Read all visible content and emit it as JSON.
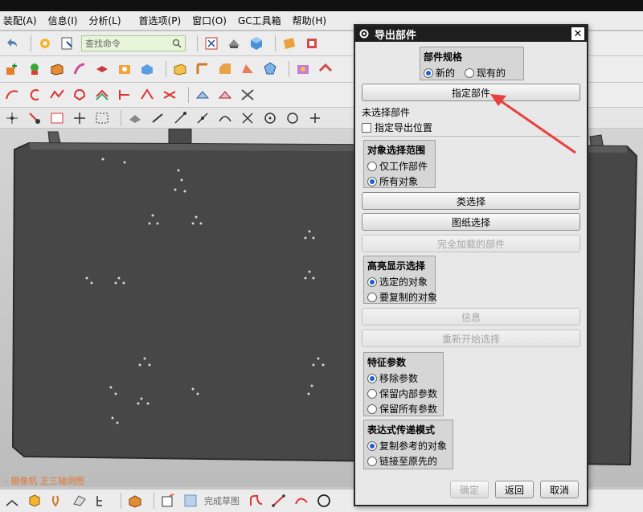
{
  "menubar": {
    "items": [
      "装配(A)",
      "信息(I)",
      "分析(L)",
      "首选项(P)",
      "窗口(O)",
      "GC工具箱",
      "帮助(H)"
    ]
  },
  "toolbar": {
    "search_placeholder": "查找命令"
  },
  "viewport": {
    "camera_label": "- 摄像机 正三轴测图"
  },
  "bottombar": {
    "finish_sketch": "完成草图"
  },
  "dialog": {
    "title": "导出部件",
    "spec_group": {
      "title": "部件规格",
      "options": [
        "新的",
        "现有的"
      ],
      "selected": 0
    },
    "specify_part_button": "指定部件",
    "no_part_selected": "未选择部件",
    "specify_export_location": "指定导出位置",
    "object_scope_group": {
      "title": "对象选择范围",
      "options": [
        "仅工作部件",
        "所有对象"
      ],
      "selected": 1
    },
    "class_select_button": "类选择",
    "drawing_select_button": "图纸选择",
    "fully_loaded_button": "完全加载的部件",
    "highlight_group": {
      "title": "高亮显示选择",
      "options": [
        "选定的对象",
        "要复制的对象"
      ],
      "selected": 0
    },
    "info_button": "信息",
    "restart_select_button": "重新开始选择",
    "feature_params_group": {
      "title": "特征参数",
      "options": [
        "移除参数",
        "保留内部参数",
        "保留所有参数"
      ],
      "selected": 0
    },
    "expression_mode_group": {
      "title": "表达式传递模式",
      "options": [
        "复制参考的对象",
        "链接至原先的"
      ],
      "selected": 0
    },
    "ok_button": "确定",
    "back_button": "返回",
    "cancel_button": "取消"
  },
  "colors": {
    "annotation_arrow": "#e8423f",
    "selected_radio": "#1c5fd0",
    "model_body": "#474747"
  }
}
